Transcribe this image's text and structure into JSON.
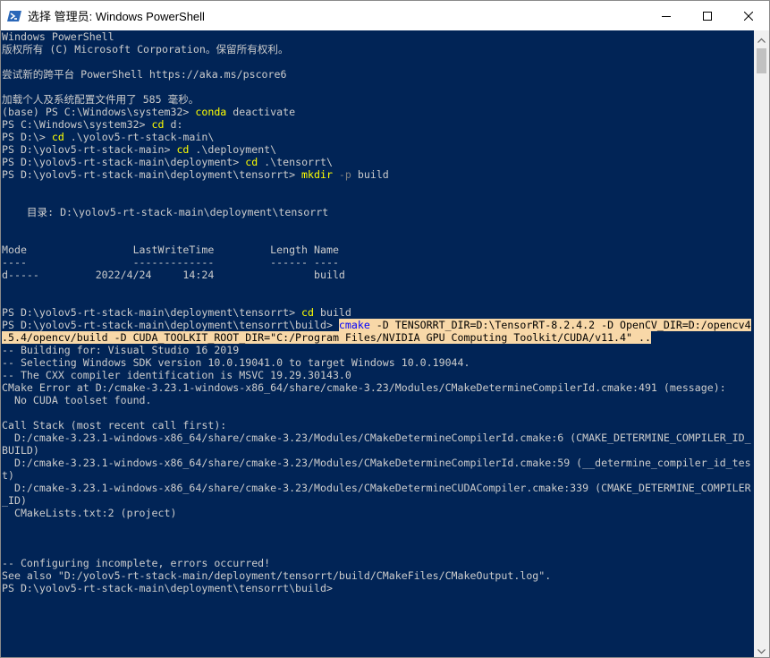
{
  "window": {
    "title": "选择 管理员: Windows PowerShell",
    "icon": "powershell-icon",
    "buttons": [
      "minimize-icon",
      "maximize-icon",
      "close-icon"
    ]
  },
  "colors": {
    "console_bg": "#012456",
    "console_fg": "#cccccc",
    "command": "#ffff00",
    "parameter": "#808080",
    "selection_bg": "#f8d8a8"
  },
  "console": {
    "banner1": "Windows PowerShell",
    "banner2": "版权所有 (C) Microsoft Corporation。保留所有权利。",
    "banner3": "尝试新的跨平台 PowerShell https://aka.ms/pscore6",
    "banner4": "加载个人及系统配置文件用了 585 毫秒。",
    "p_base": "(base) PS C:\\Windows\\system32> ",
    "c_conda": "conda",
    "a_conda": " deactivate",
    "p_sys32": "PS C:\\Windows\\system32> ",
    "c_cd1": "cd",
    "a_cd1": " d:",
    "p_d": "PS D:\\> ",
    "c_cd2": "cd",
    "a_cd2": " .\\yolov5-rt-stack-main\\",
    "p_stack": "PS D:\\yolov5-rt-stack-main> ",
    "c_cd3": "cd",
    "a_cd3": " .\\deployment\\",
    "p_deploy": "PS D:\\yolov5-rt-stack-main\\deployment> ",
    "c_cd4": "cd",
    "a_cd4": " .\\tensorrt\\",
    "p_trt1": "PS D:\\yolov5-rt-stack-main\\deployment\\tensorrt> ",
    "c_mkdir": "mkdir",
    "f_mkdir": " -p",
    "a_mkdir": " build",
    "dir_header": "    目录: D:\\yolov5-rt-stack-main\\deployment\\tensorrt",
    "col_header": "Mode                 LastWriteTime         Length Name",
    "col_rule": "----                 -------------         ------ ----",
    "dir_row": "d-----         2022/4/24     14:24                build",
    "p_trt2": "PS D:\\yolov5-rt-stack-main\\deployment\\tensorrt> ",
    "c_cd5": "cd",
    "a_cd5": " build",
    "p_build": "PS D:\\yolov5-rt-stack-main\\deployment\\tensorrt\\build> ",
    "sel1_cmd": "cmake",
    "sel1_rest": " -D TENSORRT_DIR=D:\\TensorRT-8.2.4.2 -D OpenCV_DIR=D:/opencv4",
    "sel2": ".5.4/opencv/build -D CUDA_TOOLKIT_ROOT_DIR=\"C:/Program Files/NVIDIA GPU Computing Toolkit/CUDA/v11.4\" ..",
    "out1": "-- Building for: Visual Studio 16 2019",
    "out2": "-- Selecting Windows SDK version 10.0.19041.0 to target Windows 10.0.19044.",
    "out3": "-- The CXX compiler identification is MSVC 19.29.30143.0",
    "out4": "CMake Error at D:/cmake-3.23.1-windows-x86_64/share/cmake-3.23/Modules/CMakeDetermineCompilerId.cmake:491 (message):",
    "out5": "  No CUDA toolset found.",
    "out6": "Call Stack (most recent call first):",
    "out7": "  D:/cmake-3.23.1-windows-x86_64/share/cmake-3.23/Modules/CMakeDetermineCompilerId.cmake:6 (CMAKE_DETERMINE_COMPILER_ID_",
    "out8": "BUILD)",
    "out9": "  D:/cmake-3.23.1-windows-x86_64/share/cmake-3.23/Modules/CMakeDetermineCompilerId.cmake:59 (__determine_compiler_id_tes",
    "out10": "t)",
    "out11": "  D:/cmake-3.23.1-windows-x86_64/share/cmake-3.23/Modules/CMakeDetermineCUDACompiler.cmake:339 (CMAKE_DETERMINE_COMPILER",
    "out12": "_ID)",
    "out13": "  CMakeLists.txt:2 (project)",
    "out14": "-- Configuring incomplete, errors occurred!",
    "out15": "See also \"D:/yolov5-rt-stack-main/deployment/tensorrt/build/CMakeFiles/CMakeOutput.log\".",
    "p_final": "PS D:\\yolov5-rt-stack-main\\deployment\\tensorrt\\build>"
  }
}
